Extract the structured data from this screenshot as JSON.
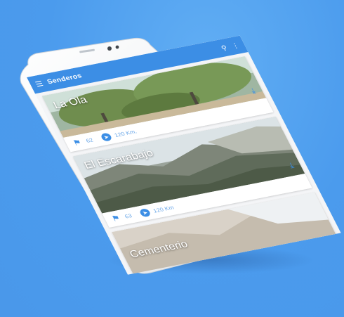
{
  "appbar": {
    "menu_icon": "menu-icon",
    "title": "Senderos",
    "search_icon": "search-icon",
    "more_icon": "more-icon",
    "color": "#3c8ee5"
  },
  "routes": [
    {
      "name": "La Ola",
      "people": "62",
      "distance": "120 Km."
    },
    {
      "name": "El Escarabajo",
      "people": "63",
      "distance": "120 Km"
    },
    {
      "name": "Cementerio"
    }
  ],
  "colors": {
    "background": "#4a99ec",
    "accent": "#3c8ee5",
    "phone": "#f1f2f4"
  }
}
